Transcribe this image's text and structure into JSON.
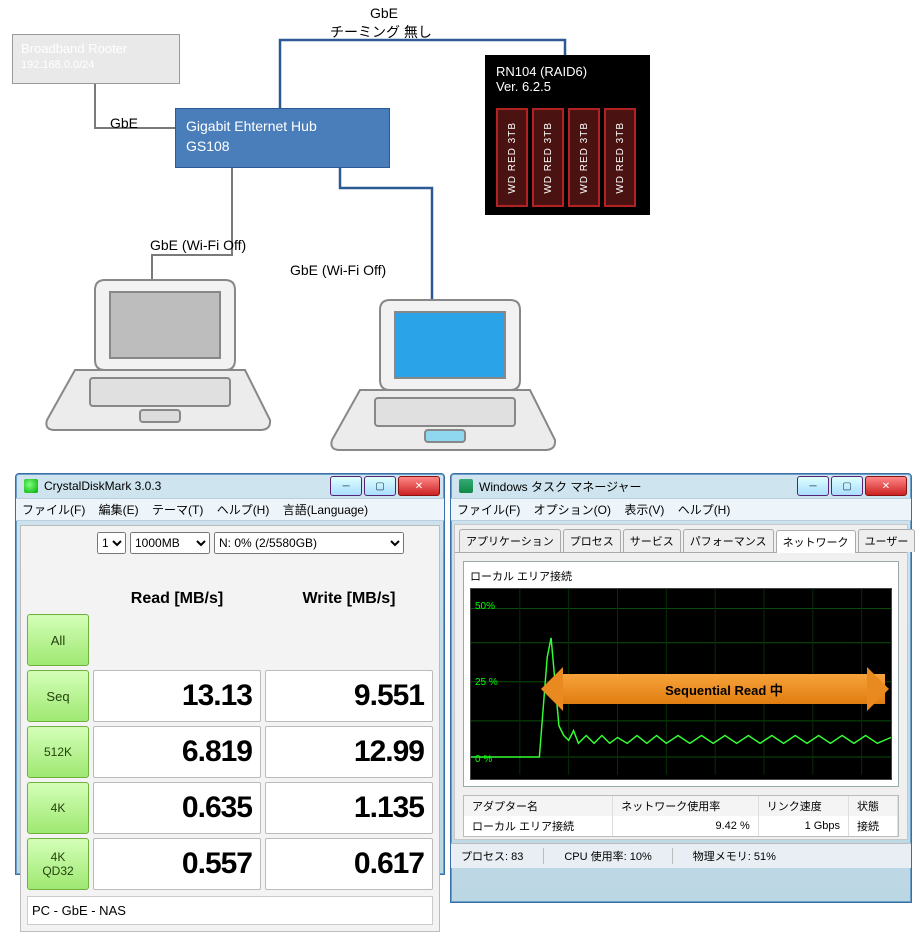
{
  "diagram": {
    "router": {
      "title": "Broadband Rooter",
      "subnet": "192.168.0.0/24"
    },
    "router_link": "GbE",
    "hub": {
      "title": "Gigabit Ehternet Hub",
      "model": "GS108"
    },
    "top_link": "GbE",
    "teaming": "チーミング 無し",
    "nas": {
      "title": "RN104 (RAID6)",
      "version": "Ver. 6.2.5",
      "drive_label": "WD RED 3TB"
    },
    "pc_left_link": "GbE  (Wi-Fi Off)",
    "pc_right_link": "GbE  (Wi-Fi Off)"
  },
  "cdm": {
    "title": "CrystalDiskMark 3.0.3",
    "menu": {
      "file": "ファイル(F)",
      "edit": "編集(E)",
      "theme": "テーマ(T)",
      "help": "ヘルプ(H)",
      "lang": "言語(Language)"
    },
    "runs": "1",
    "size": "1000MB",
    "drive": "N: 0% (2/5580GB)",
    "head_read": "Read [MB/s]",
    "head_write": "Write [MB/s]",
    "buttons": {
      "all": "All",
      "seq": "Seq",
      "k512": "512K",
      "k4": "4K",
      "k4q": "4K",
      "k4q2": "QD32"
    },
    "vals": {
      "seq_r": "13.13",
      "seq_w": "9.551",
      "k512_r": "6.819",
      "k512_w": "12.99",
      "k4_r": "0.635",
      "k4_w": "1.135",
      "k4q_r": "0.557",
      "k4q_w": "0.617"
    },
    "footer": "PC - GbE - NAS"
  },
  "tm": {
    "title": "Windows タスク マネージャー",
    "menu": {
      "file": "ファイル(F)",
      "options": "オプション(O)",
      "view": "表示(V)",
      "help": "ヘルプ(H)"
    },
    "tabs": {
      "app": "アプリケーション",
      "proc": "プロセス",
      "svc": "サービス",
      "perf": "パフォーマンス",
      "net": "ネットワーク",
      "user": "ユーザー"
    },
    "graph_title": "ローカル エリア接続",
    "y50": "50%",
    "y25": "25 %",
    "y0": "0 %",
    "arrow": "Sequential Read 中",
    "cols": {
      "name": "アダプター名",
      "usage": "ネットワーク使用率",
      "speed": "リンク速度",
      "state": "状態"
    },
    "row": {
      "name": "ローカル エリア接続",
      "usage": "9.42 %",
      "speed": "1 Gbps",
      "state": "接続"
    },
    "status": {
      "proc": "プロセス: 83",
      "cpu": "CPU 使用率: 10%",
      "mem": "物理メモリ: 51%"
    }
  }
}
